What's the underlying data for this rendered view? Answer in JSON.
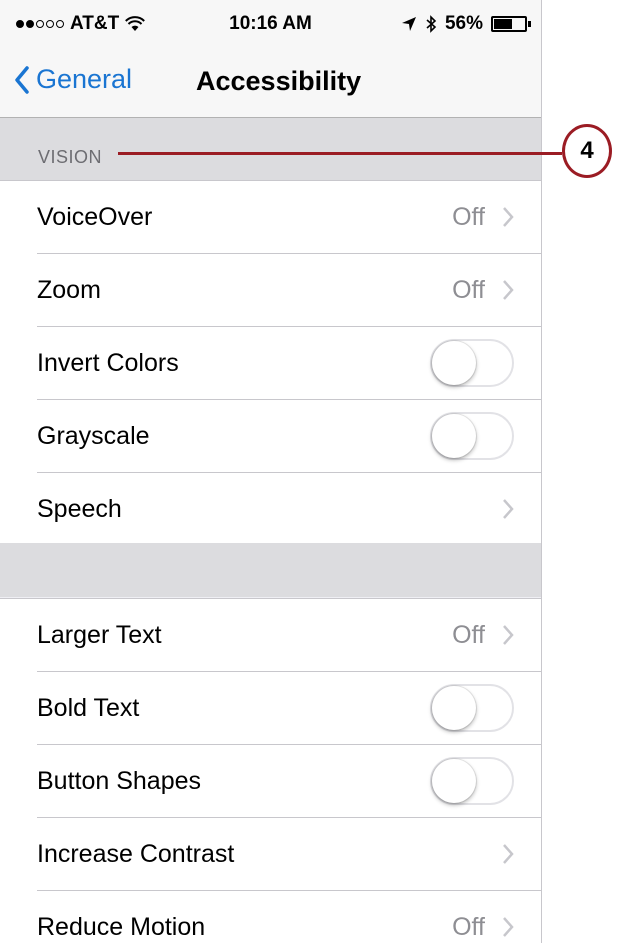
{
  "status_bar": {
    "carrier": "AT&T",
    "time": "10:16 AM",
    "battery_percent": "56%",
    "signal_bars_filled": 2,
    "signal_bars_total": 5
  },
  "nav": {
    "back_label": "General",
    "title": "Accessibility"
  },
  "section_vision": {
    "header": "VISION",
    "rows": [
      {
        "label": "VoiceOver",
        "value": "Off",
        "control": "chevron"
      },
      {
        "label": "Zoom",
        "value": "Off",
        "control": "chevron"
      },
      {
        "label": "Invert Colors",
        "control": "toggle",
        "on": false
      },
      {
        "label": "Grayscale",
        "control": "toggle",
        "on": false
      },
      {
        "label": "Speech",
        "control": "chevron"
      }
    ]
  },
  "section_text": {
    "rows": [
      {
        "label": "Larger Text",
        "value": "Off",
        "control": "chevron"
      },
      {
        "label": "Bold Text",
        "control": "toggle",
        "on": false
      },
      {
        "label": "Button Shapes",
        "control": "toggle",
        "on": false
      },
      {
        "label": "Increase Contrast",
        "control": "chevron"
      },
      {
        "label": "Reduce Motion",
        "value": "Off",
        "control": "chevron"
      }
    ]
  },
  "callout": {
    "number": "4",
    "color": "#9b1c24"
  },
  "colors": {
    "accent": "#1a75d2",
    "group_bg": "#efeff4",
    "secondary_text": "#8e8e93"
  },
  "icons": {
    "back": "chevron-left-icon",
    "row_chevron": "chevron-right-icon",
    "wifi": "wifi-icon",
    "location": "location-arrow-icon",
    "bluetooth": "bluetooth-icon",
    "battery": "battery-icon"
  }
}
